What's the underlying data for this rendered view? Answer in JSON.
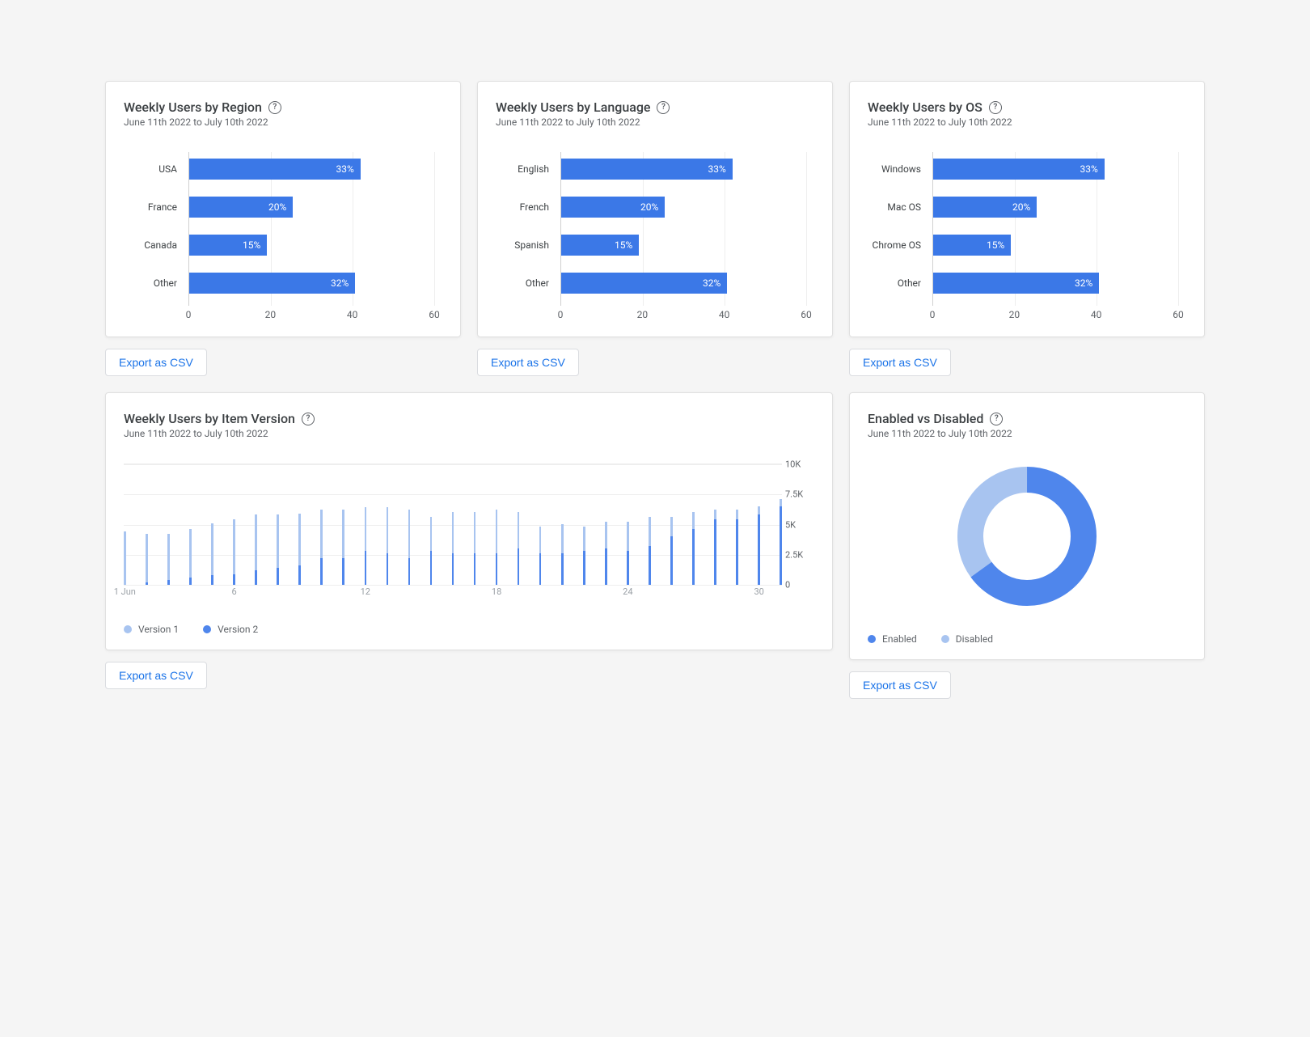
{
  "date_range": "June 11th 2022 to July 10th 2022",
  "export_label": "Export as CSV",
  "cards": {
    "region": {
      "title": "Weekly Users by Region"
    },
    "language": {
      "title": "Weekly Users by Language"
    },
    "os": {
      "title": "Weekly Users by OS"
    },
    "version": {
      "title": "Weekly Users by Item Version"
    },
    "enabled": {
      "title": "Enabled vs Disabled"
    }
  },
  "legend": {
    "v1": "Version 1",
    "v2": "Version 2",
    "enabled": "Enabled",
    "disabled": "Disabled"
  },
  "chart_data": [
    {
      "id": "region",
      "type": "bar",
      "orientation": "horizontal",
      "categories": [
        "USA",
        "France",
        "Canada",
        "Other"
      ],
      "values": [
        33,
        20,
        15,
        32
      ],
      "value_suffix": "%",
      "xlim": [
        0,
        60
      ],
      "xticks": [
        0,
        20,
        40,
        60
      ]
    },
    {
      "id": "language",
      "type": "bar",
      "orientation": "horizontal",
      "categories": [
        "English",
        "French",
        "Spanish",
        "Other"
      ],
      "values": [
        33,
        20,
        15,
        32
      ],
      "value_suffix": "%",
      "xlim": [
        0,
        60
      ],
      "xticks": [
        0,
        20,
        40,
        60
      ]
    },
    {
      "id": "os",
      "type": "bar",
      "orientation": "horizontal",
      "categories": [
        "Windows",
        "Mac OS",
        "Chrome OS",
        "Other"
      ],
      "values": [
        33,
        20,
        15,
        32
      ],
      "value_suffix": "%",
      "xlim": [
        0,
        60
      ],
      "xticks": [
        0,
        20,
        40,
        60
      ]
    },
    {
      "id": "version",
      "type": "bar",
      "stacked": true,
      "x": [
        1,
        2,
        3,
        4,
        5,
        6,
        7,
        8,
        9,
        10,
        11,
        12,
        13,
        14,
        15,
        16,
        17,
        18,
        19,
        20,
        21,
        22,
        23,
        24,
        25,
        26,
        27,
        28,
        29,
        30,
        31
      ],
      "series": [
        {
          "name": "Version 1",
          "color": "#a8c4f0",
          "values": [
            4400,
            4000,
            3800,
            4000,
            4300,
            4500,
            4600,
            4400,
            4300,
            4000,
            4000,
            3600,
            3800,
            4000,
            2800,
            3400,
            3400,
            3600,
            3000,
            2200,
            2400,
            2000,
            2200,
            2400,
            2400,
            1600,
            1400,
            800,
            800,
            700,
            600
          ]
        },
        {
          "name": "Version 2",
          "color": "#4f86ec",
          "values": [
            0,
            200,
            400,
            600,
            800,
            900,
            1200,
            1400,
            1600,
            2200,
            2200,
            2800,
            2600,
            2200,
            2800,
            2600,
            2600,
            2600,
            3000,
            2600,
            2600,
            2800,
            3000,
            2800,
            3200,
            4000,
            4600,
            5400,
            5400,
            5800,
            6500
          ]
        }
      ],
      "ylim": [
        0,
        10000
      ],
      "yticks": [
        0,
        2500,
        5000,
        7500,
        10000
      ],
      "ytick_labels": [
        "0",
        "2.5K",
        "5K",
        "7.5K",
        "10K"
      ],
      "xticks": [
        1,
        6,
        12,
        18,
        24,
        30
      ],
      "xtick_labels": [
        "1 Jun",
        "6",
        "12",
        "18",
        "24",
        "30"
      ]
    },
    {
      "id": "enabled",
      "type": "pie",
      "donut": true,
      "series": [
        {
          "name": "Enabled",
          "value": 65,
          "color": "#4f86ec"
        },
        {
          "name": "Disabled",
          "value": 35,
          "color": "#a8c4f0"
        }
      ]
    }
  ]
}
